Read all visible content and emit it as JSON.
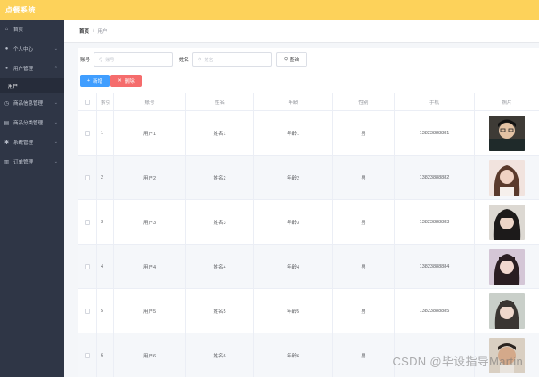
{
  "app": {
    "title": "点餐系统"
  },
  "sidebar": {
    "items": [
      {
        "label": "首页",
        "icon": "home-icon",
        "glyph": "⌂",
        "chevron": false
      },
      {
        "label": "个人中心",
        "icon": "user-icon",
        "glyph": "●",
        "chevron": true
      },
      {
        "label": "用户管理",
        "icon": "users-icon",
        "glyph": "●",
        "chevron": true
      },
      {
        "label": "商品信息管理",
        "icon": "clock-icon",
        "glyph": "◷",
        "chevron": true
      },
      {
        "label": "商品分类管理",
        "icon": "document-icon",
        "glyph": "▤",
        "chevron": true
      },
      {
        "label": "系统管理",
        "icon": "gear-icon",
        "glyph": "✱",
        "chevron": true
      },
      {
        "label": "订单管理",
        "icon": "chart-icon",
        "glyph": "▥",
        "chevron": true
      }
    ],
    "submenu": {
      "label": "用户"
    }
  },
  "breadcrumb": {
    "home": "首页",
    "separator": "/",
    "current": "用户"
  },
  "search": {
    "account_label": "账号",
    "account_placeholder": "账号",
    "name_label": "姓名",
    "name_placeholder": "姓名",
    "search_button": "查询"
  },
  "actions": {
    "add": "新增",
    "delete": "删除"
  },
  "table": {
    "headers": [
      "索引",
      "账号",
      "姓名",
      "年龄",
      "性别",
      "手机",
      "照片"
    ],
    "rows": [
      {
        "index": "1",
        "account": "用户1",
        "name": "姓名1",
        "age": "年龄1",
        "gender": "男",
        "phone": "13823888881"
      },
      {
        "index": "2",
        "account": "用户2",
        "name": "姓名2",
        "age": "年龄2",
        "gender": "男",
        "phone": "13823888882"
      },
      {
        "index": "3",
        "account": "用户3",
        "name": "姓名3",
        "age": "年龄3",
        "gender": "男",
        "phone": "13823888883"
      },
      {
        "index": "4",
        "account": "用户4",
        "name": "姓名4",
        "age": "年龄4",
        "gender": "男",
        "phone": "13823888884"
      },
      {
        "index": "5",
        "account": "用户5",
        "name": "姓名5",
        "age": "年龄5",
        "gender": "男",
        "phone": "13823888885"
      },
      {
        "index": "6",
        "account": "用户6",
        "name": "姓名6",
        "age": "年龄6",
        "gender": "男",
        "phone": ""
      }
    ]
  },
  "watermark": "CSDN @毕设指导Martin",
  "colors": {
    "topbar": "#fdd25a",
    "sidebar": "#2f3646",
    "primary": "#409eff",
    "danger": "#f56c6c"
  }
}
